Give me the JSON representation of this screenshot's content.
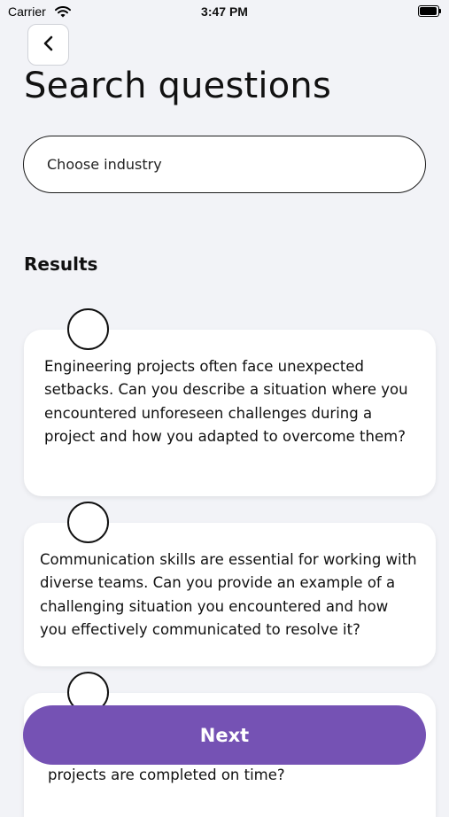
{
  "status_bar": {
    "carrier": "Carrier",
    "time": "3:47 PM"
  },
  "header": {
    "title": "Search questions"
  },
  "filter": {
    "industry_placeholder": "Choose industry"
  },
  "results": {
    "heading": "Results",
    "questions": [
      {
        "text": "Engineering projects often face unexpected setbacks. Can you describe a situation where you encountered unforeseen challenges during a project and how you adapted to overcome them?",
        "selected": false
      },
      {
        "text": "Communication skills are essential for working with diverse teams. Can you provide an example of a challenging situation you encountered and how you effectively communicated to resolve it?",
        "selected": false
      },
      {
        "text": "projects are completed on time?",
        "selected": false
      }
    ]
  },
  "footer": {
    "next_label": "Next"
  },
  "colors": {
    "accent": "#7552b4",
    "background": "#f2f3f7",
    "card": "#ffffff"
  }
}
